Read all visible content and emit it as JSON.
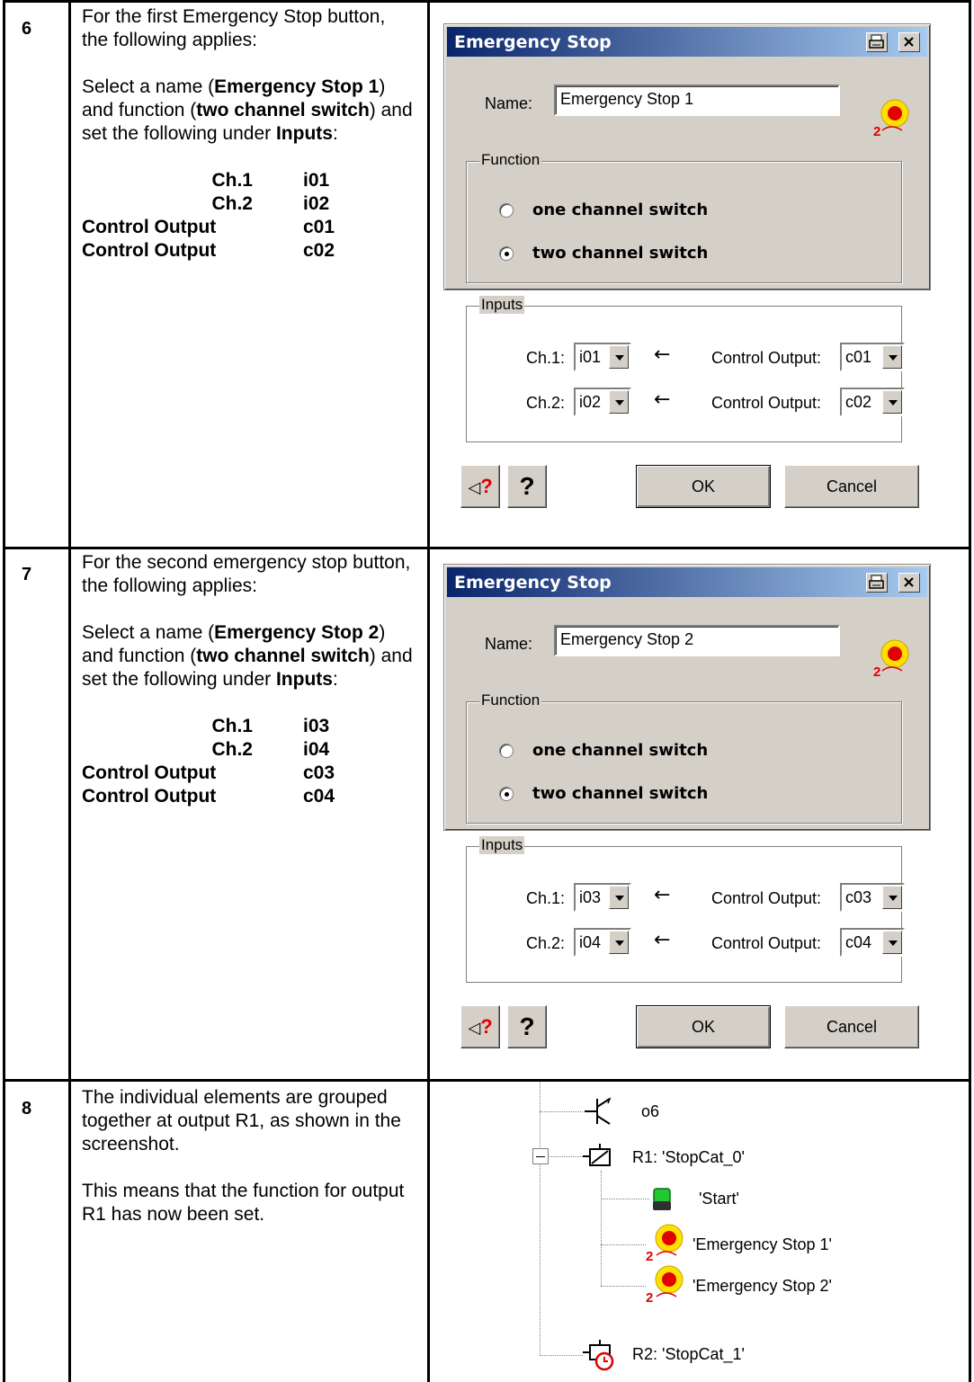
{
  "steps": [
    {
      "number": "6",
      "description": {
        "intro": "For the first Emergency Stop button, the following applies:",
        "select_pre": "Select a name (",
        "name_bold": "Emergency Stop 1",
        "select_mid": ") and function (",
        "function_bold": "two channel switch",
        "select_post": ") and set the following under ",
        "inputs_bold": "Inputs",
        "colon": ":"
      },
      "io": [
        [
          "Ch.1",
          "i01"
        ],
        [
          "Ch.2",
          "i02"
        ],
        [
          "Control Output",
          "c01"
        ],
        [
          "Control Output",
          "c02"
        ]
      ],
      "dialog": {
        "title": "Emergency Stop",
        "name_label": "Name:",
        "name_value": "Emergency Stop 1",
        "function_group": "Function",
        "radio_one": "one channel switch",
        "radio_two": "two channel switch",
        "selected_radio": "two channel switch",
        "inputs_group": "Inputs",
        "ch1_label": "Ch.1:",
        "ch1_value": "i01",
        "ch2_label": "Ch.2:",
        "ch2_value": "i02",
        "ctrl_label": "Control Output:",
        "ctrl1_value": "c01",
        "ctrl2_value": "c02",
        "ok": "OK",
        "cancel": "Cancel",
        "help_glyph": "?",
        "context_help_glyph": "?"
      }
    },
    {
      "number": "7",
      "description": {
        "intro": "For the second emergency stop button, the following applies:",
        "select_pre": "Select a name (",
        "name_bold": "Emergency Stop 2",
        "select_mid": ") and function (",
        "function_bold": "two channel switch",
        "select_post": ") and set the following under ",
        "inputs_bold": "Inputs",
        "colon": ":"
      },
      "io": [
        [
          "Ch.1",
          "i03"
        ],
        [
          "Ch.2",
          "i04"
        ],
        [
          "Control Output",
          "c03"
        ],
        [
          "Control Output",
          "c04"
        ]
      ],
      "dialog": {
        "title": "Emergency Stop",
        "name_label": "Name:",
        "name_value": "Emergency Stop 2",
        "function_group": "Function",
        "radio_one": "one channel switch",
        "radio_two": "two channel switch",
        "selected_radio": "two channel switch",
        "inputs_group": "Inputs",
        "ch1_label": "Ch.1:",
        "ch1_value": "i03",
        "ch2_label": "Ch.2:",
        "ch2_value": "i04",
        "ctrl_label": "Control Output:",
        "ctrl1_value": "c03",
        "ctrl2_value": "c04",
        "ok": "OK",
        "cancel": "Cancel",
        "help_glyph": "?",
        "context_help_glyph": "?"
      }
    },
    {
      "number": "8",
      "description": {
        "p1": "The individual elements are grouped together at output R1, as shown in the screenshot.",
        "p2": "This means that the function for output R1 has now been set."
      },
      "tree": {
        "o6": "o6",
        "r1": "R1: 'StopCat_0'",
        "start": "'Start'",
        "estop1": "'Emergency Stop 1'",
        "estop2": "'Emergency Stop 2'",
        "r2": "R2: 'StopCat_1'",
        "estop_badge": "2"
      }
    }
  ],
  "colors": {
    "dialog_face": "#d4d0c8",
    "title_start": "#0a246a",
    "title_end": "#a6caf0",
    "estop_red": "#e00000",
    "estop_yellow": "#ffe000",
    "start_green": "#22c832"
  }
}
